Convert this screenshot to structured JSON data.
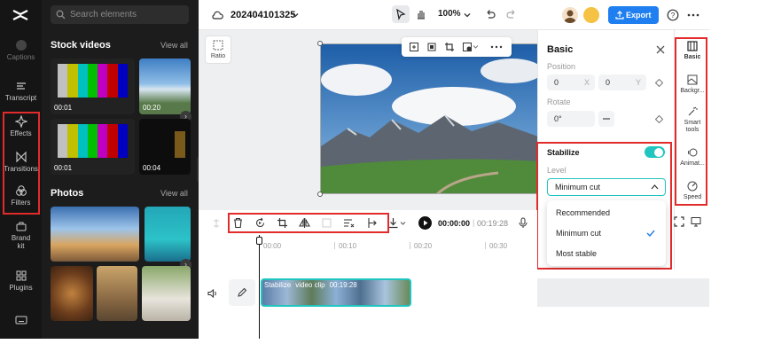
{
  "rail": {
    "items": [
      {
        "label": "Captions"
      },
      {
        "label": "Transcript"
      },
      {
        "label": "Effects"
      },
      {
        "label": "Transitions"
      },
      {
        "label": "Filters"
      },
      {
        "label": "Brand kit"
      },
      {
        "label": "Plugins"
      }
    ]
  },
  "media": {
    "search_placeholder": "Search elements",
    "stock_title": "Stock videos",
    "stock_viewall": "View all",
    "stock_durations": [
      "00:01",
      "00:20",
      "00:01",
      "00:04"
    ],
    "photos_title": "Photos",
    "photos_viewall": "View all"
  },
  "topbar": {
    "project_name": "20240410132​5",
    "zoom": "100%",
    "export_label": "Export"
  },
  "canvas": {
    "ratio_label": "Ratio"
  },
  "panel": {
    "title": "Basic",
    "position_label": "Position",
    "pos_x": "0",
    "pos_x_unit": "X",
    "pos_y": "0",
    "pos_y_unit": "Y",
    "rotate_label": "Rotate",
    "rotate_value": "0°",
    "stabilize_label": "Stabilize",
    "level_label": "Level",
    "level_value": "Minimum cut",
    "options": [
      "Recommended",
      "Minimum cut",
      "Most stable"
    ],
    "selected_option": "Minimum cut"
  },
  "right_tabs": [
    {
      "label": "Basic"
    },
    {
      "label": "Backgr..."
    },
    {
      "label": "Smart tools"
    },
    {
      "label": "Animat..."
    },
    {
      "label": "Speed"
    }
  ],
  "timeline": {
    "current_time": "00:00:00",
    "total_time": "00:19:28",
    "ruler": [
      "00:00",
      "00:10",
      "00:20",
      "00:30"
    ],
    "clip_effect": "Stabilize",
    "clip_name": "video clip",
    "clip_duration": "00:19:28"
  },
  "colors": {
    "accent": "#1f7ff0",
    "teal": "#20c5c0",
    "highlight": "#e22b2b"
  }
}
